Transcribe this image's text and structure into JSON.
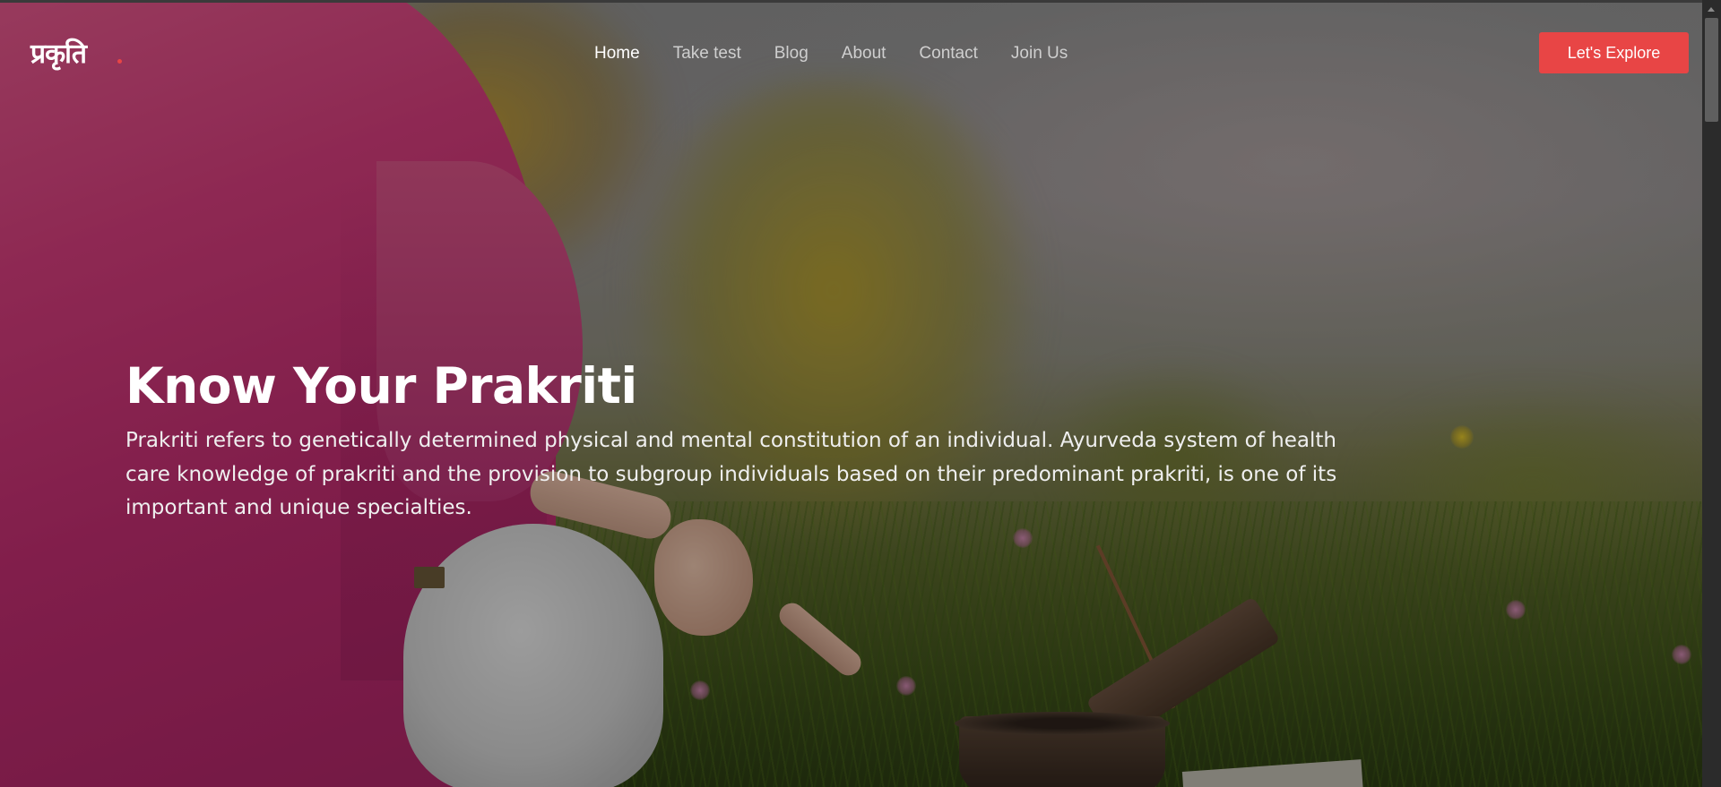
{
  "header": {
    "logo_text": "प्रकृति",
    "nav": [
      {
        "label": "Home",
        "active": true
      },
      {
        "label": "Take test",
        "active": false
      },
      {
        "label": "Blog",
        "active": false
      },
      {
        "label": "About",
        "active": false
      },
      {
        "label": "Contact",
        "active": false
      },
      {
        "label": "Join Us",
        "active": false
      }
    ],
    "cta_label": "Let's Explore"
  },
  "hero": {
    "title": "Know Your Prakriti",
    "description": "Prakriti refers to genetically determined physical and mental constitution of an individual. Ayurveda system of health care knowledge of prakriti and the provision to subgroup individuals based on their predominant prakriti, is one of its important and unique specialties."
  },
  "colors": {
    "accent": "#e84545",
    "text_primary": "#ffffff",
    "nav_inactive": "#cfcfcf"
  }
}
